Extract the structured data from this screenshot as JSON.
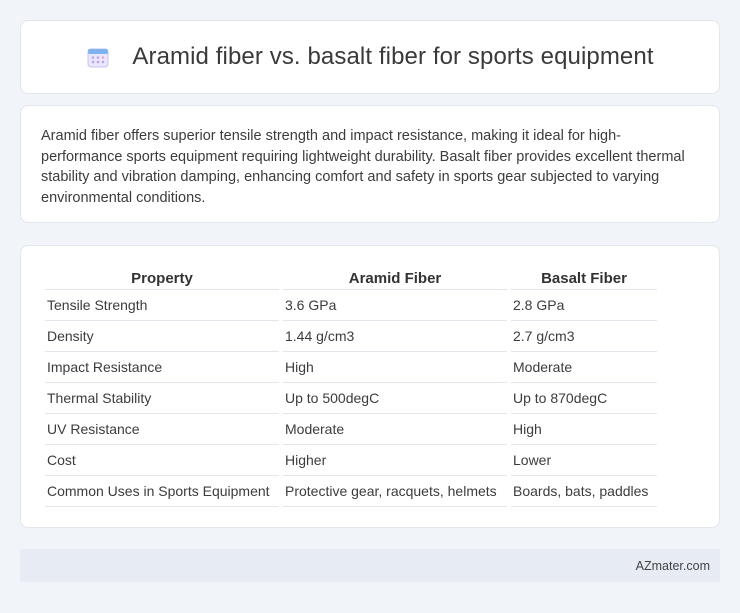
{
  "header": {
    "title": "Aramid fiber vs. basalt fiber for sports equipment",
    "icon": "calendar-icon"
  },
  "description": "Aramid fiber offers superior tensile strength and impact resistance, making it ideal for high-performance sports equipment requiring lightweight durability. Basalt fiber provides excellent thermal stability and vibration damping, enhancing comfort and safety in sports gear subjected to varying environmental conditions.",
  "table": {
    "headers": [
      "Property",
      "Aramid Fiber",
      "Basalt Fiber"
    ],
    "rows": [
      [
        "Tensile Strength",
        "3.6 GPa",
        "2.8 GPa"
      ],
      [
        "Density",
        "1.44 g/cm3",
        "2.7 g/cm3"
      ],
      [
        "Impact Resistance",
        "High",
        "Moderate"
      ],
      [
        "Thermal Stability",
        "Up to 500degC",
        "Up to 870degC"
      ],
      [
        "UV Resistance",
        "Moderate",
        "High"
      ],
      [
        "Cost",
        "Higher",
        "Lower"
      ],
      [
        "Common Uses in Sports Equipment",
        "Protective gear, racquets, helmets",
        "Boards, bats, paddles"
      ]
    ]
  },
  "footer": {
    "text": "AZmater.com"
  },
  "colors": {
    "background": "#f1f4f9",
    "card": "#ffffff",
    "footer": "#e6ebf4"
  }
}
